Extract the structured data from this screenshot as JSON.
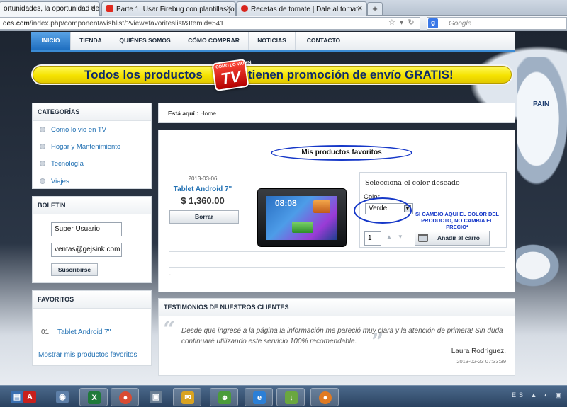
{
  "browser": {
    "tabs": [
      {
        "label": "ortunidades, la oportunidad de ...",
        "favicon_color": "#f2f2f2",
        "active": true
      },
      {
        "label": "Parte 1. Usar Firebug con plantillas jo...",
        "favicon_color": "#e02a1f",
        "active": false
      },
      {
        "label": "Recetas de tomate | Dale al tomate",
        "favicon_color": "#d8241c",
        "active": false
      }
    ],
    "new_tab_label": "+",
    "url_host": "des.com",
    "url_path": "/index.php/component/wishlist/?view=favoriteslist&Itemid=541",
    "search_placeholder": "Google",
    "search_engine_letter": "g"
  },
  "site_menu": {
    "items": [
      "INICIO",
      "TIENDA",
      "QUIÉNES SOMOS",
      "CÓMO COMPRAR",
      "NOTICIAS",
      "CONTACTO"
    ]
  },
  "promo": {
    "text_before": "Todos los productos",
    "text_after": "tienen promoción de envío GRATIS!",
    "logo_small": "COMO LO VIO EN",
    "logo_big": "TV"
  },
  "deco_label": "PAIN",
  "categories": {
    "title": "CATEGORÍAS",
    "items": [
      "Como lo vio en TV",
      "Hogar y Mantenimiento",
      "Tecnología",
      "Viajes"
    ]
  },
  "newsletter": {
    "title": "BOLETIN",
    "name_value": "Super Usuario",
    "email_value": "ventas@gejsink.com",
    "subscribe_label": "Suscribirse"
  },
  "favorites_sidebar": {
    "title": "FAVORITOS",
    "item_number": "01",
    "item_label": "Tablet Android 7\"",
    "show_all_label": "Mostrar mis productos favoritos"
  },
  "breadcrumb": {
    "prefix": "Está aquí :",
    "current": "Home"
  },
  "favorites": {
    "title": "Mis productos favoritos",
    "product": {
      "date": "2013-03-06",
      "name": "Tablet Android 7\"",
      "price": "$ 1,360.00",
      "delete_label": "Borrar",
      "tablet_clock": "08:08"
    },
    "options": {
      "title": "Selecciona el color deseado",
      "color_label": "Color",
      "color_value": "Verde",
      "quantity": "1",
      "add_to_cart_label": "Añadir al carro"
    },
    "annotation": "SI CAMBIO AQUI EL COLOR DEL PRODUCTO, NO CAMBIA EL PRECIO*",
    "footer_dash": "-"
  },
  "testimonials": {
    "title": "TESTIMONIOS DE NUESTROS CLIENTES",
    "text": "Desde que ingresé a la página la información me pareció muy clara y la atención de primera! Sin duda continuaré utilizando este servicio 100% recomendable.",
    "author": "Laura Rodríguez.",
    "date": "2013-02-23 07:33:39"
  },
  "taskbar": {
    "apps": [
      {
        "name": "windows-explorer-icon",
        "color": "#3a6fb0",
        "glyph": "▤"
      },
      {
        "name": "acrobat-icon",
        "color": "#c8201c",
        "glyph": "A"
      },
      {
        "name": "app-icon",
        "color": "#5d7fa8",
        "glyph": "◉"
      },
      {
        "name": "excel-icon",
        "color": "#1f7a3a",
        "glyph": "X"
      },
      {
        "name": "chrome-icon",
        "color": "#d94b32",
        "glyph": "●"
      },
      {
        "name": "firebug-icon",
        "color": "#6b7f94",
        "glyph": "▣"
      },
      {
        "name": "outlook-icon",
        "color": "#d9a321",
        "glyph": "✉"
      },
      {
        "name": "messenger-icon",
        "color": "#4b9c3a",
        "glyph": "☻"
      },
      {
        "name": "internet-explorer-icon",
        "color": "#2b7fd6",
        "glyph": "e"
      },
      {
        "name": "download-icon",
        "color": "#6aa73f",
        "glyph": "↓"
      },
      {
        "name": "firefox-icon",
        "color": "#e07a22",
        "glyph": "●"
      }
    ],
    "tray": "ES ▲ ◐ ▣"
  }
}
